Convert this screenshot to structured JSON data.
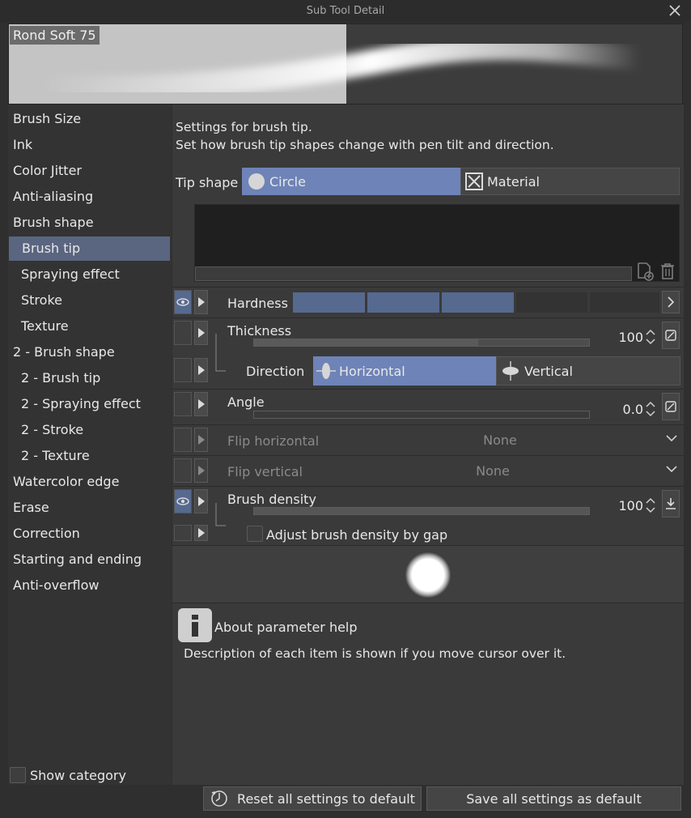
{
  "window": {
    "title": "Sub Tool Detail"
  },
  "preview": {
    "brush_name": "Rond Soft 75"
  },
  "sidebar": {
    "items": [
      {
        "label": "Brush Size"
      },
      {
        "label": "Ink"
      },
      {
        "label": "Color Jitter"
      },
      {
        "label": "Anti-aliasing"
      },
      {
        "label": "Brush shape"
      },
      {
        "label": "Brush tip"
      },
      {
        "label": "Spraying effect"
      },
      {
        "label": "Stroke"
      },
      {
        "label": "Texture"
      },
      {
        "label": "2 - Brush shape"
      },
      {
        "label": "2 - Brush tip"
      },
      {
        "label": "2 - Spraying effect"
      },
      {
        "label": "2 - Stroke"
      },
      {
        "label": "2 - Texture"
      },
      {
        "label": "Watercolor edge"
      },
      {
        "label": "Erase"
      },
      {
        "label": "Correction"
      },
      {
        "label": "Starting and ending"
      },
      {
        "label": "Anti-overflow"
      }
    ],
    "active": "Brush tip",
    "show_category_label": "Show category"
  },
  "main": {
    "description_line1": "Settings for brush tip.",
    "description_line2": "Set how brush tip shapes change with pen tilt and direction.",
    "tip_shape": {
      "label": "Tip shape",
      "options": [
        "Circle",
        "Material"
      ],
      "selected": "Circle"
    },
    "hardness": {
      "label": "Hardness",
      "level": 3,
      "segments": 5
    },
    "thickness": {
      "label": "Thickness",
      "value": "100",
      "fill_fraction": 0.67
    },
    "direction": {
      "label": "Direction",
      "options": [
        "Horizontal",
        "Vertical"
      ],
      "selected": "Horizontal"
    },
    "angle": {
      "label": "Angle",
      "value": "0.0"
    },
    "flip_horizontal": {
      "label": "Flip horizontal",
      "value": "None"
    },
    "flip_vertical": {
      "label": "Flip vertical",
      "value": "None"
    },
    "brush_density": {
      "label": "Brush density",
      "value": "100"
    },
    "adjust_density": {
      "label": "Adjust brush density by gap",
      "checked": false
    },
    "help": {
      "title": "About parameter help",
      "description": "Description of each item is shown if you move cursor over it."
    }
  },
  "footer": {
    "reset_label": "Reset all settings to default",
    "save_label": "Save all settings as default"
  },
  "colors": {
    "accent": "#6e83b7",
    "sidebar_active": "#5a6580",
    "eye_on": "#56698f",
    "background": "#2f2f2f"
  }
}
